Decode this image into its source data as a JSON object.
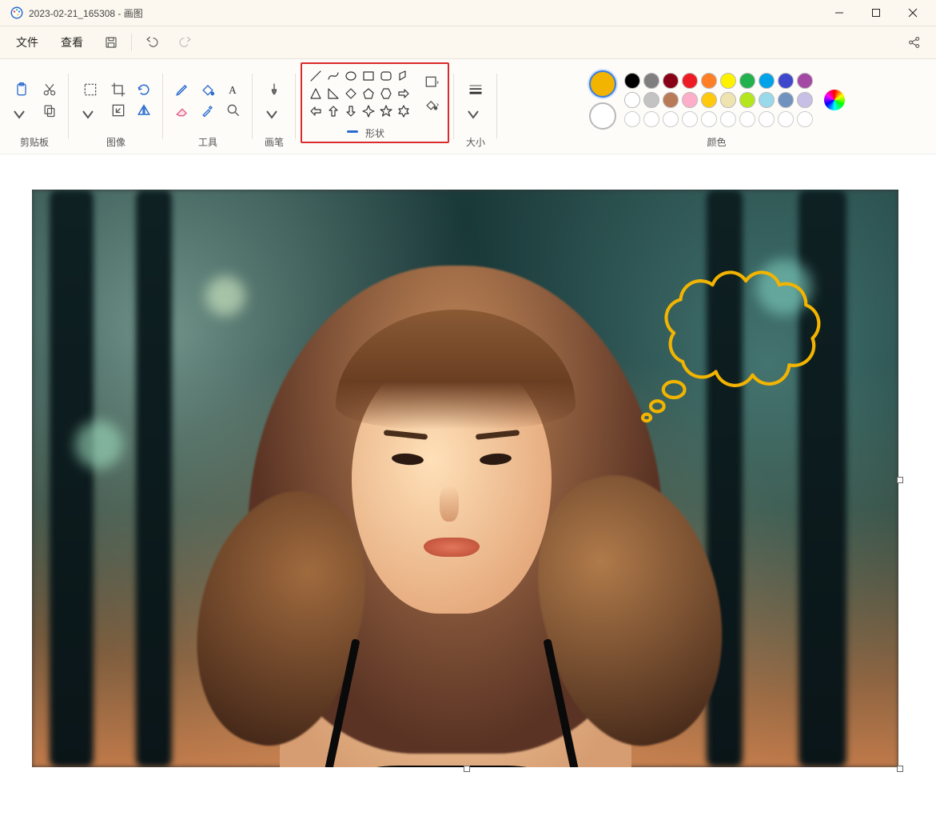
{
  "window": {
    "title": "2023-02-21_165308 - 画图"
  },
  "menu": {
    "file": "文件",
    "view": "查看"
  },
  "ribbon": {
    "clipboard": "剪贴板",
    "image": "图像",
    "tools": "工具",
    "brushes": "画笔",
    "shapes": "形状",
    "size": "大小",
    "colors": "颜色"
  },
  "colors": {
    "primary": "#f2b400",
    "secondary": "#ffffff",
    "palette_row1": [
      "#000000",
      "#7f7f7f",
      "#880015",
      "#ed1c24",
      "#ff7f27",
      "#fff200",
      "#22b14c",
      "#00a2e8",
      "#3f48cc",
      "#a349a4"
    ],
    "palette_row2": [
      "#ffffff",
      "#c3c3c3",
      "#b97a57",
      "#ffaec9",
      "#ffc90e",
      "#efe4b0",
      "#b5e61d",
      "#99d9ea",
      "#7092be",
      "#c8bfe7"
    ]
  },
  "highlight": {
    "target": "shapes-group",
    "color": "#d92b2b"
  },
  "canvas": {
    "thought_bubble_color": "#f2b400",
    "description": "portrait photo of a young woman with long brown hair, bangs, black spaghetti-strap top, blurred teal-green forest background with warm light; yellow cloud thought-bubble drawn at upper right"
  }
}
